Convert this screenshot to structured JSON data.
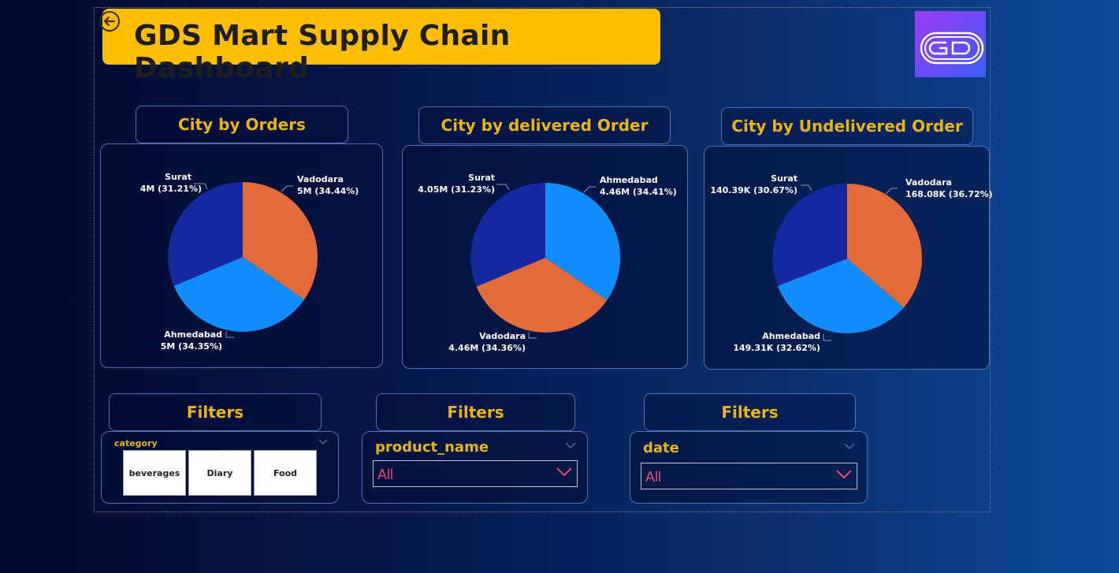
{
  "header": {
    "title": "GDS Mart Supply Chain Dashboard",
    "back_icon": "back-arrow-icon",
    "logo_icon": "gd-logo-icon"
  },
  "colors": {
    "title_bg": "#ffbf00",
    "panel_title": "#e8b418",
    "surat": "#1428a0",
    "vadodara": "#e46c3a",
    "ahmedabad": "#118dff",
    "dropdown_value": "#e0506e"
  },
  "charts": [
    {
      "title": "City by Orders",
      "slices": [
        {
          "city": "Vadodara",
          "value": "5M (34.44%)",
          "pct": 34.44
        },
        {
          "city": "Ahmedabad",
          "value": "5M (34.35%)",
          "pct": 34.35
        },
        {
          "city": "Surat",
          "value": "4M (31.21%)",
          "pct": 31.21
        }
      ]
    },
    {
      "title": "City by delivered Order",
      "slices": [
        {
          "city": "Ahmedabad",
          "value": "4.46M (34.41%)",
          "pct": 34.41
        },
        {
          "city": "Vadodara",
          "value": "4.46M (34.36%)",
          "pct": 34.36
        },
        {
          "city": "Surat",
          "value": "4.05M (31.23%)",
          "pct": 31.23
        }
      ]
    },
    {
      "title": "City by Undelivered Order",
      "slices": [
        {
          "city": "Vadodara",
          "value": "168.08K (36.72%)",
          "pct": 36.72
        },
        {
          "city": "Ahmedabad",
          "value": "149.31K (32.62%)",
          "pct": 32.62
        },
        {
          "city": "Surat",
          "value": "140.39K (30.67%)",
          "pct": 30.67
        }
      ]
    }
  ],
  "filters": [
    {
      "title": "Filters",
      "field": "category",
      "options": [
        "beverages",
        "Diary",
        "Food"
      ]
    },
    {
      "title": "Filters",
      "field": "product_name",
      "value": "All"
    },
    {
      "title": "Filters",
      "field": "date",
      "value": "All"
    }
  ]
}
